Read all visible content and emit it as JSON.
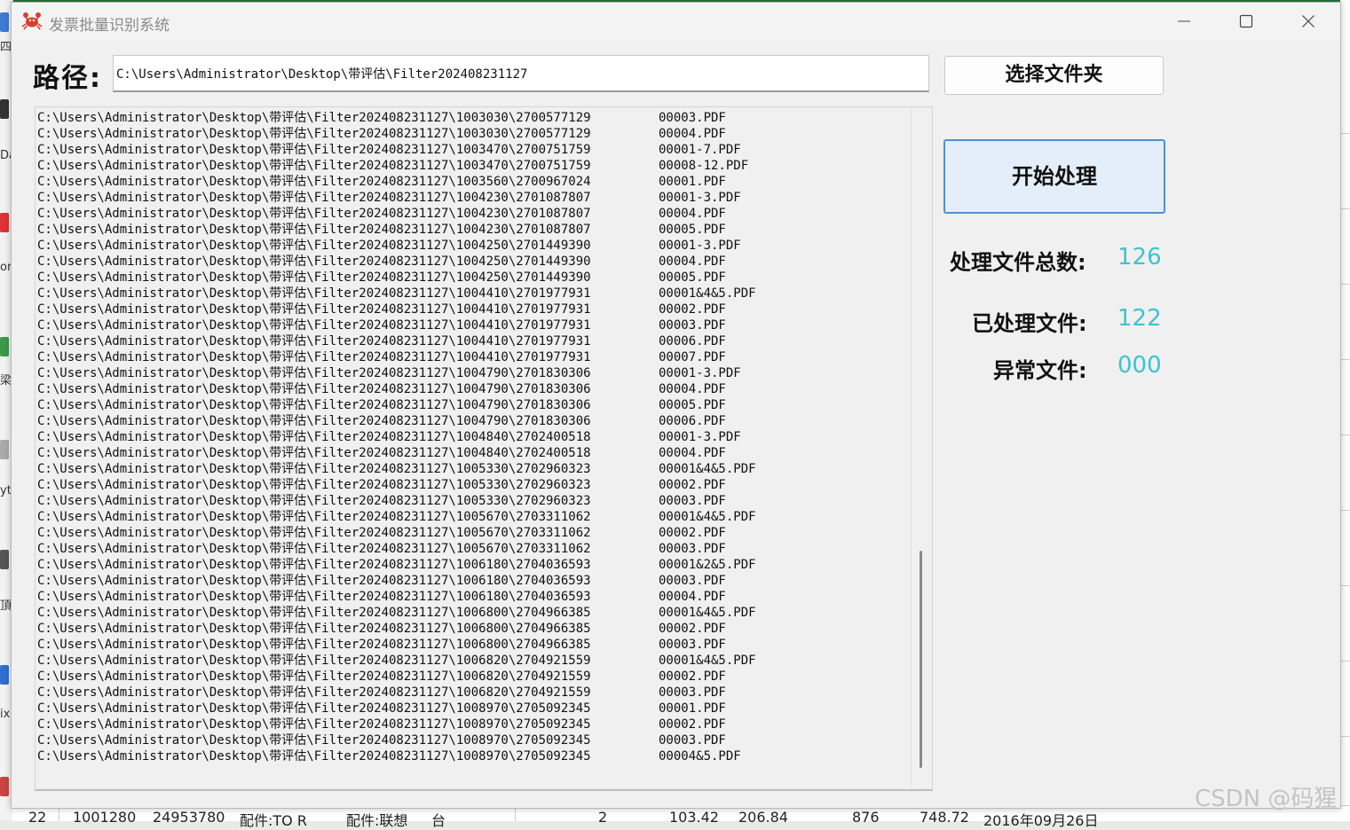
{
  "window": {
    "title": "发票批量识别系统"
  },
  "path": {
    "label": "路径:",
    "value": "C:\\Users\\Administrator\\Desktop\\带评估\\Filter202408231127"
  },
  "buttons": {
    "select_folder": "选择文件夹",
    "start": "开始处理"
  },
  "log": [
    {
      "path": "C:\\Users\\Administrator\\Desktop\\带评估\\Filter202408231127\\1003030\\2700577129",
      "file": "00003.PDF"
    },
    {
      "path": "C:\\Users\\Administrator\\Desktop\\带评估\\Filter202408231127\\1003030\\2700577129",
      "file": "00004.PDF"
    },
    {
      "path": "C:\\Users\\Administrator\\Desktop\\带评估\\Filter202408231127\\1003470\\2700751759",
      "file": "00001-7.PDF"
    },
    {
      "path": "C:\\Users\\Administrator\\Desktop\\带评估\\Filter202408231127\\1003470\\2700751759",
      "file": "00008-12.PDF"
    },
    {
      "path": "C:\\Users\\Administrator\\Desktop\\带评估\\Filter202408231127\\1003560\\2700967024",
      "file": "00001.PDF"
    },
    {
      "path": "C:\\Users\\Administrator\\Desktop\\带评估\\Filter202408231127\\1004230\\2701087807",
      "file": "00001-3.PDF"
    },
    {
      "path": "C:\\Users\\Administrator\\Desktop\\带评估\\Filter202408231127\\1004230\\2701087807",
      "file": "00004.PDF"
    },
    {
      "path": "C:\\Users\\Administrator\\Desktop\\带评估\\Filter202408231127\\1004230\\2701087807",
      "file": "00005.PDF"
    },
    {
      "path": "C:\\Users\\Administrator\\Desktop\\带评估\\Filter202408231127\\1004250\\2701449390",
      "file": "00001-3.PDF"
    },
    {
      "path": "C:\\Users\\Administrator\\Desktop\\带评估\\Filter202408231127\\1004250\\2701449390",
      "file": "00004.PDF"
    },
    {
      "path": "C:\\Users\\Administrator\\Desktop\\带评估\\Filter202408231127\\1004250\\2701449390",
      "file": "00005.PDF"
    },
    {
      "path": "C:\\Users\\Administrator\\Desktop\\带评估\\Filter202408231127\\1004410\\2701977931",
      "file": "00001&4&5.PDF"
    },
    {
      "path": "C:\\Users\\Administrator\\Desktop\\带评估\\Filter202408231127\\1004410\\2701977931",
      "file": "00002.PDF"
    },
    {
      "path": "C:\\Users\\Administrator\\Desktop\\带评估\\Filter202408231127\\1004410\\2701977931",
      "file": "00003.PDF"
    },
    {
      "path": "C:\\Users\\Administrator\\Desktop\\带评估\\Filter202408231127\\1004410\\2701977931",
      "file": "00006.PDF"
    },
    {
      "path": "C:\\Users\\Administrator\\Desktop\\带评估\\Filter202408231127\\1004410\\2701977931",
      "file": "00007.PDF"
    },
    {
      "path": "C:\\Users\\Administrator\\Desktop\\带评估\\Filter202408231127\\1004790\\2701830306",
      "file": "00001-3.PDF"
    },
    {
      "path": "C:\\Users\\Administrator\\Desktop\\带评估\\Filter202408231127\\1004790\\2701830306",
      "file": "00004.PDF"
    },
    {
      "path": "C:\\Users\\Administrator\\Desktop\\带评估\\Filter202408231127\\1004790\\2701830306",
      "file": "00005.PDF"
    },
    {
      "path": "C:\\Users\\Administrator\\Desktop\\带评估\\Filter202408231127\\1004790\\2701830306",
      "file": "00006.PDF"
    },
    {
      "path": "C:\\Users\\Administrator\\Desktop\\带评估\\Filter202408231127\\1004840\\2702400518",
      "file": "00001-3.PDF"
    },
    {
      "path": "C:\\Users\\Administrator\\Desktop\\带评估\\Filter202408231127\\1004840\\2702400518",
      "file": "00004.PDF"
    },
    {
      "path": "C:\\Users\\Administrator\\Desktop\\带评估\\Filter202408231127\\1005330\\2702960323",
      "file": "00001&4&5.PDF"
    },
    {
      "path": "C:\\Users\\Administrator\\Desktop\\带评估\\Filter202408231127\\1005330\\2702960323",
      "file": "00002.PDF"
    },
    {
      "path": "C:\\Users\\Administrator\\Desktop\\带评估\\Filter202408231127\\1005330\\2702960323",
      "file": "00003.PDF"
    },
    {
      "path": "C:\\Users\\Administrator\\Desktop\\带评估\\Filter202408231127\\1005670\\2703311062",
      "file": "00001&4&5.PDF"
    },
    {
      "path": "C:\\Users\\Administrator\\Desktop\\带评估\\Filter202408231127\\1005670\\2703311062",
      "file": "00002.PDF"
    },
    {
      "path": "C:\\Users\\Administrator\\Desktop\\带评估\\Filter202408231127\\1005670\\2703311062",
      "file": "00003.PDF"
    },
    {
      "path": "C:\\Users\\Administrator\\Desktop\\带评估\\Filter202408231127\\1006180\\2704036593",
      "file": "00001&2&5.PDF"
    },
    {
      "path": "C:\\Users\\Administrator\\Desktop\\带评估\\Filter202408231127\\1006180\\2704036593",
      "file": "00003.PDF"
    },
    {
      "path": "C:\\Users\\Administrator\\Desktop\\带评估\\Filter202408231127\\1006180\\2704036593",
      "file": "00004.PDF"
    },
    {
      "path": "C:\\Users\\Administrator\\Desktop\\带评估\\Filter202408231127\\1006800\\2704966385",
      "file": "00001&4&5.PDF"
    },
    {
      "path": "C:\\Users\\Administrator\\Desktop\\带评估\\Filter202408231127\\1006800\\2704966385",
      "file": "00002.PDF"
    },
    {
      "path": "C:\\Users\\Administrator\\Desktop\\带评估\\Filter202408231127\\1006800\\2704966385",
      "file": "00003.PDF"
    },
    {
      "path": "C:\\Users\\Administrator\\Desktop\\带评估\\Filter202408231127\\1006820\\2704921559",
      "file": "00001&4&5.PDF"
    },
    {
      "path": "C:\\Users\\Administrator\\Desktop\\带评估\\Filter202408231127\\1006820\\2704921559",
      "file": "00002.PDF"
    },
    {
      "path": "C:\\Users\\Administrator\\Desktop\\带评估\\Filter202408231127\\1006820\\2704921559",
      "file": "00003.PDF"
    },
    {
      "path": "C:\\Users\\Administrator\\Desktop\\带评估\\Filter202408231127\\1008970\\2705092345",
      "file": "00001.PDF"
    },
    {
      "path": "C:\\Users\\Administrator\\Desktop\\带评估\\Filter202408231127\\1008970\\2705092345",
      "file": "00002.PDF"
    },
    {
      "path": "C:\\Users\\Administrator\\Desktop\\带评估\\Filter202408231127\\1008970\\2705092345",
      "file": "00003.PDF"
    },
    {
      "path": "C:\\Users\\Administrator\\Desktop\\带评估\\Filter202408231127\\1008970\\2705092345",
      "file": "00004&5.PDF"
    }
  ],
  "stats": {
    "total_label": "处理文件总数:",
    "total_value": "126",
    "processed_label": "已处理文件:",
    "processed_value": "122",
    "error_label": "异常文件:",
    "error_value": "000"
  },
  "background": {
    "left_fragments": [
      "四",
      "Da",
      "or",
      "梁",
      "yt",
      "頂",
      "ix"
    ],
    "bottom_row": [
      "22",
      "1001280",
      "24953780",
      "配件:TO R",
      "配件:联想",
      "台",
      "2",
      "103.42",
      "206.84",
      "876",
      "748.72",
      "2016年09月26日"
    ]
  },
  "watermark": "CSDN @码猩",
  "colors": {
    "accent_blue": "#4d90d8",
    "stat_value": "#3cc4cf",
    "window_bg": "#f0f0f0"
  },
  "icons": {
    "app": "crab-icon",
    "minimize": "minimize-icon",
    "maximize": "maximize-icon",
    "close": "close-icon"
  }
}
